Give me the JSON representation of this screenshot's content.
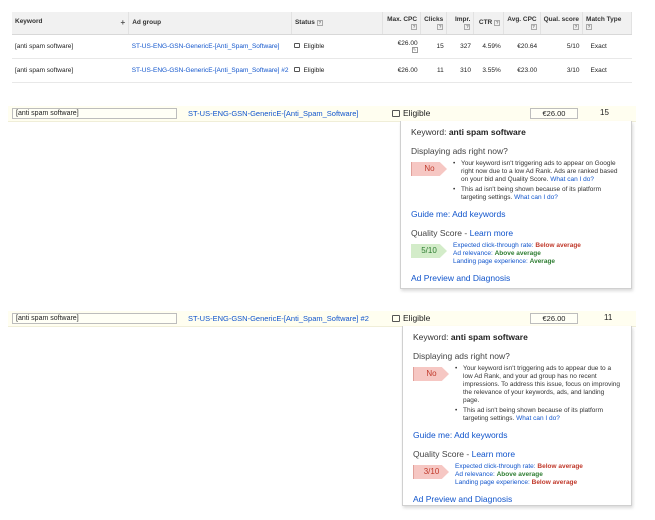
{
  "table": {
    "headers": {
      "keyword": "Keyword",
      "ad_group": "Ad group",
      "status": "Status",
      "max_cpc": "Max. CPC",
      "clicks": "Clicks",
      "impr": "Impr.",
      "ctr": "CTR",
      "avg_cpc": "Avg. CPC",
      "qual_score": "Qual. score",
      "match_type": "Match Type"
    },
    "help_glyph": "?",
    "sort_glyph": "+",
    "rows": [
      {
        "keyword": "[anti spam software]",
        "ad_group": "ST-US-ENG-GSN-GenericE-[Anti_Spam_Software]",
        "status": "Eligible",
        "max_cpc": "€26.00",
        "clicks": "15",
        "impr": "327",
        "ctr": "4.59%",
        "avg_cpc": "€20.64",
        "qual_score": "5/10",
        "match_type": "Exact"
      },
      {
        "keyword": "[anti spam software]",
        "ad_group": "ST-US-ENG-GSN-GenericE-[Anti_Spam_Software] #2",
        "status": "Eligible",
        "max_cpc": "€26.00",
        "clicks": "11",
        "impr": "310",
        "ctr": "3.55%",
        "avg_cpc": "€23.00",
        "qual_score": "3/10",
        "match_type": "Exact"
      }
    ]
  },
  "detail1": {
    "keyword": "[anti spam software]",
    "ad_group": "ST-US-ENG-GSN-GenericE-[Anti_Spam_Software]",
    "status": "Eligible",
    "max_cpc": "€26.00",
    "clicks": "15",
    "popup": {
      "keyword_label": "Keyword:",
      "keyword_value": "anti spam software",
      "displaying_heading": "Displaying ads right now?",
      "answer": "No",
      "bullet1_text": "Your keyword isn't triggering ads to appear on Google right now due to a low Ad Rank. Ads are ranked based on your bid and Quality Score.",
      "bullet1_link": "What can I do?",
      "bullet2_text": "This ad isn't being shown because of its platform targeting settings.",
      "bullet2_link": "What can I do?",
      "guide_link": "Guide me: Add keywords",
      "qs_label": "Quality Score -",
      "qs_link": "Learn more",
      "qs_value": "5/10",
      "ctr_label": "Expected click-through rate:",
      "ctr_value": "Below average",
      "relevance_label": "Ad relevance:",
      "relevance_value": "Above average",
      "landing_label": "Landing page experience:",
      "landing_value": "Average",
      "preview_link": "Ad Preview and Diagnosis"
    }
  },
  "detail2": {
    "keyword": "[anti spam software]",
    "ad_group": "ST-US-ENG-GSN-GenericE-[Anti_Spam_Software] #2",
    "status": "Eligible",
    "max_cpc": "€26.00",
    "clicks": "11",
    "popup": {
      "keyword_label": "Keyword:",
      "keyword_value": "anti spam software",
      "displaying_heading": "Displaying ads right now?",
      "answer": "No",
      "bullet1_text": "Your keyword isn't triggering ads to appear due to a low Ad Rank, and your ad group has no recent impressions. To address this issue, focus on improving the relevance of your keywords, ads, and landing page.",
      "bullet2_text": "This ad isn't being shown because of its platform targeting settings.",
      "bullet2_link": "What can I do?",
      "guide_link": "Guide me: Add keywords",
      "qs_label": "Quality Score -",
      "qs_link": "Learn more",
      "qs_value": "3/10",
      "ctr_label": "Expected click-through rate:",
      "ctr_value": "Below average",
      "relevance_label": "Ad relevance:",
      "relevance_value": "Above average",
      "landing_label": "Landing page experience:",
      "landing_value": "Below average",
      "preview_link": "Ad Preview and Diagnosis"
    }
  },
  "colors": {
    "link": "#1155cc",
    "bad": "#c0392b",
    "good": "#2e7d32",
    "row_highlight": "#fffef0"
  },
  "icons": {
    "status": "speech-bubble-icon",
    "help": "help-icon",
    "edit": "edit-icon",
    "sort": "plus-icon"
  }
}
